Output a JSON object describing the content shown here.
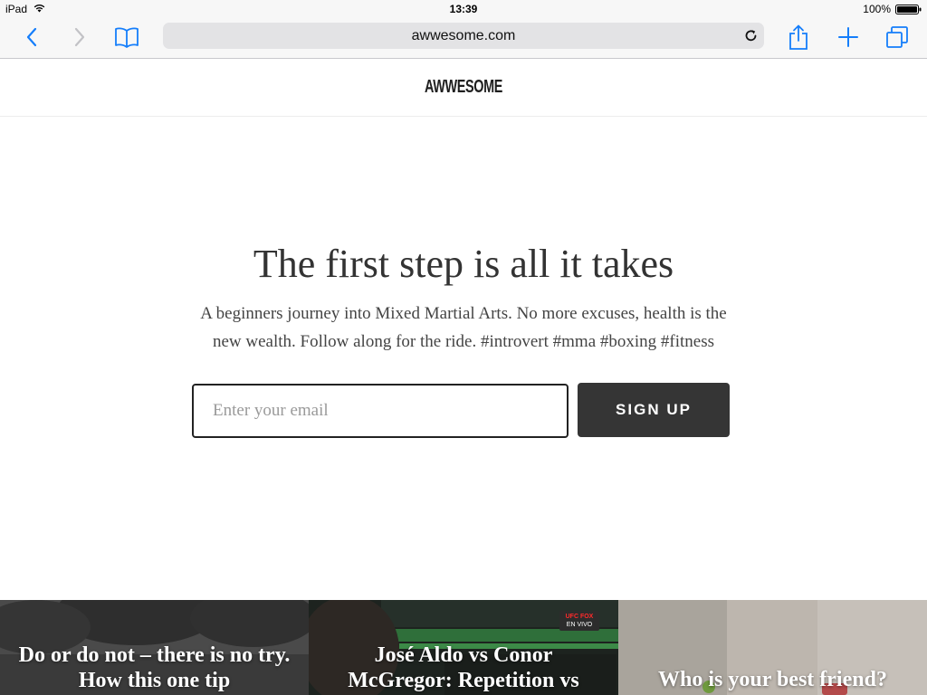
{
  "status_bar": {
    "device": "iPad",
    "time": "13:39",
    "battery": "100%"
  },
  "browser": {
    "url": "awwesome.com"
  },
  "site": {
    "logo": "AWWESOME"
  },
  "hero": {
    "title": "The first step is all it takes",
    "description": "A beginners journey into Mixed Martial Arts. No more excuses, health is the new wealth. Follow along for the ride. #introvert #mma #boxing #fitness",
    "email_placeholder": "Enter your email",
    "signup_label": "SIGN UP"
  },
  "cards": [
    {
      "title": "Do or do not – there is no try. How this one tip"
    },
    {
      "title": "José Aldo vs Conor McGregor: Repetition vs",
      "badge_line1": "UFC FOX",
      "badge_line2": "EN VIVO"
    },
    {
      "title": "Who is your best friend?"
    }
  ],
  "colors": {
    "ios_blue": "#157efb",
    "button_dark": "#353535",
    "toolbar_bg": "#f7f7f7"
  }
}
